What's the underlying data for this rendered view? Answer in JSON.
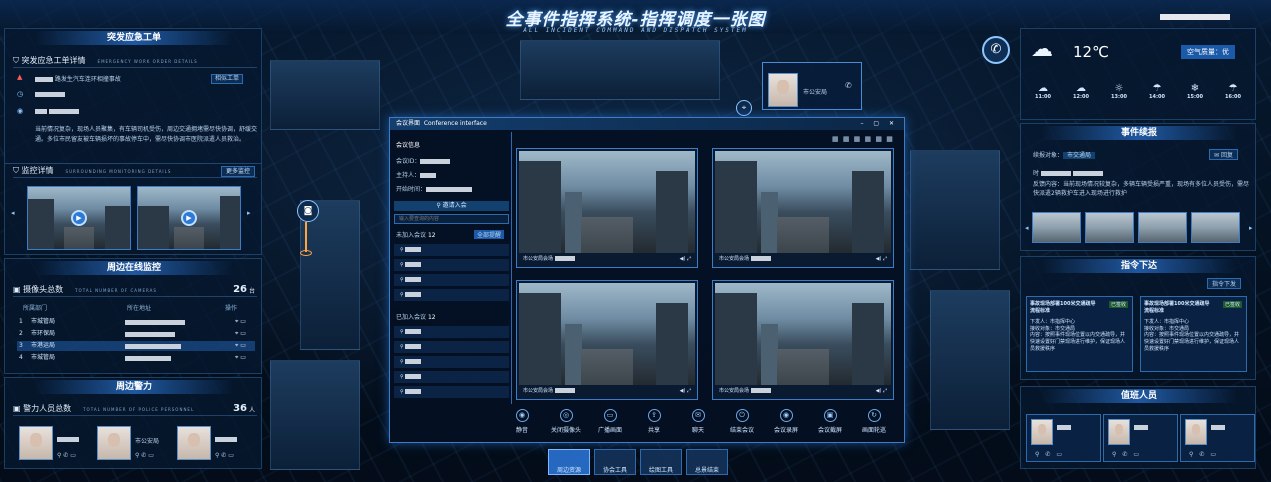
{
  "header": {
    "title": "全事件指挥系统-指挥调度一张图",
    "subtitle": "ALL INCIDENT COMMAND AND DISPATCH SYSTEM"
  },
  "left": {
    "order_panel": {
      "title": "突发应急工单",
      "section": "突发应急工单详情",
      "section_en": "EMERGENCY WORK ORDER DETAILS",
      "event": "路发生汽车连环相撞事故",
      "similar_btn": "相似工单",
      "desc": "当前情况复杂，现场人员聚集，有车辆司机受伤，周边交通拥堵需尽快协调，舒缓交通。多位市民留友被车辆损坏的事故停车中，需尽快协调市医院派遣人员救治。"
    },
    "monitor": {
      "section": "监控详情",
      "section_en": "SURROUNDING MONITORING DETAILS",
      "more_btn": "更多监控"
    },
    "online": {
      "title": "周边在线监控",
      "label": "摄像头总数",
      "label_en": "TOTAL NUMBER OF CAMERAS",
      "count": "26",
      "unit": "台",
      "headers": [
        "所属部门",
        "所在地址",
        "操作"
      ],
      "rows": [
        {
          "idx": "1",
          "dept": "市城管局"
        },
        {
          "idx": "2",
          "dept": "市环保局"
        },
        {
          "idx": "3",
          "dept": "市港运局"
        },
        {
          "idx": "4",
          "dept": "市城管局"
        }
      ]
    },
    "police": {
      "title": "周边警力",
      "label": "警力人员总数",
      "label_en": "TOTAL NUMBER OF POLICE PERSONNEL",
      "count": "36",
      "unit": "人",
      "people": [
        {
          "org": ""
        },
        {
          "org": "市公安局"
        },
        {
          "org": ""
        }
      ]
    }
  },
  "popup": {
    "org": "市公安局"
  },
  "conference": {
    "title": "会议界面",
    "title_en": "Conference interface",
    "info_title": "会议信息",
    "id_label": "会议ID：",
    "host_label": "主持人：",
    "time_label": "开始时间：",
    "invite_btn": "邀请入会",
    "search_placeholder": "输入要查询的内容",
    "not_joined_label": "未加入会议",
    "not_joined_count": "12",
    "all_invite_btn": "全部提醒",
    "joined_label": "已加入会议",
    "joined_count": "12",
    "video_label": "市公安局会场",
    "toolbar": [
      "静音",
      "关闭摄像头",
      "广播画面",
      "共享",
      "聊天",
      "结束会议",
      "会议录屏",
      "会议截屏",
      "画面轮巡"
    ]
  },
  "bottom_tabs": [
    "周边资源",
    "协会工具",
    "绘图工具",
    "总景结束"
  ],
  "right": {
    "weather": {
      "temp": "12℃",
      "aqi": "空气质量：优",
      "hours": [
        "11:00",
        "12:00",
        "13:00",
        "14:00",
        "15:00",
        "16:00"
      ]
    },
    "incident": {
      "title": "事件续报",
      "unit_label": "续报对象：",
      "unit": "市交通局",
      "reply_btn": "回复",
      "time_label": "时",
      "content": "反馈内容：当前现场情况较复杂，多辆车辆受损严重，现场有多位人员受伤，需尽快派遣2辆救护车进入现场进行救护"
    },
    "directive": {
      "title": "指令下达",
      "btn": "指令下发",
      "cards": [
        {
          "title": "事故现场部署100米交通疏导流程标准",
          "tag": "已签收",
          "from": "下发人：市指挥中心",
          "to": "接收对象：市交通局",
          "text": "内容：按照事件现场位置以内交通疏导，并快速设置好门禁现场进行维护，保证现场人员救援秩序"
        },
        {
          "title": "事故现场部署100米交通疏导流程标准",
          "tag": "已签收",
          "from": "下发人：市指挥中心",
          "to": "接收对象：市交通局",
          "text": "内容：按照事件现场位置以内交通疏导，并快速设置好门禁现场进行维护，保证现场人员救援秩序"
        }
      ]
    },
    "duty": {
      "title": "值班人员"
    }
  }
}
